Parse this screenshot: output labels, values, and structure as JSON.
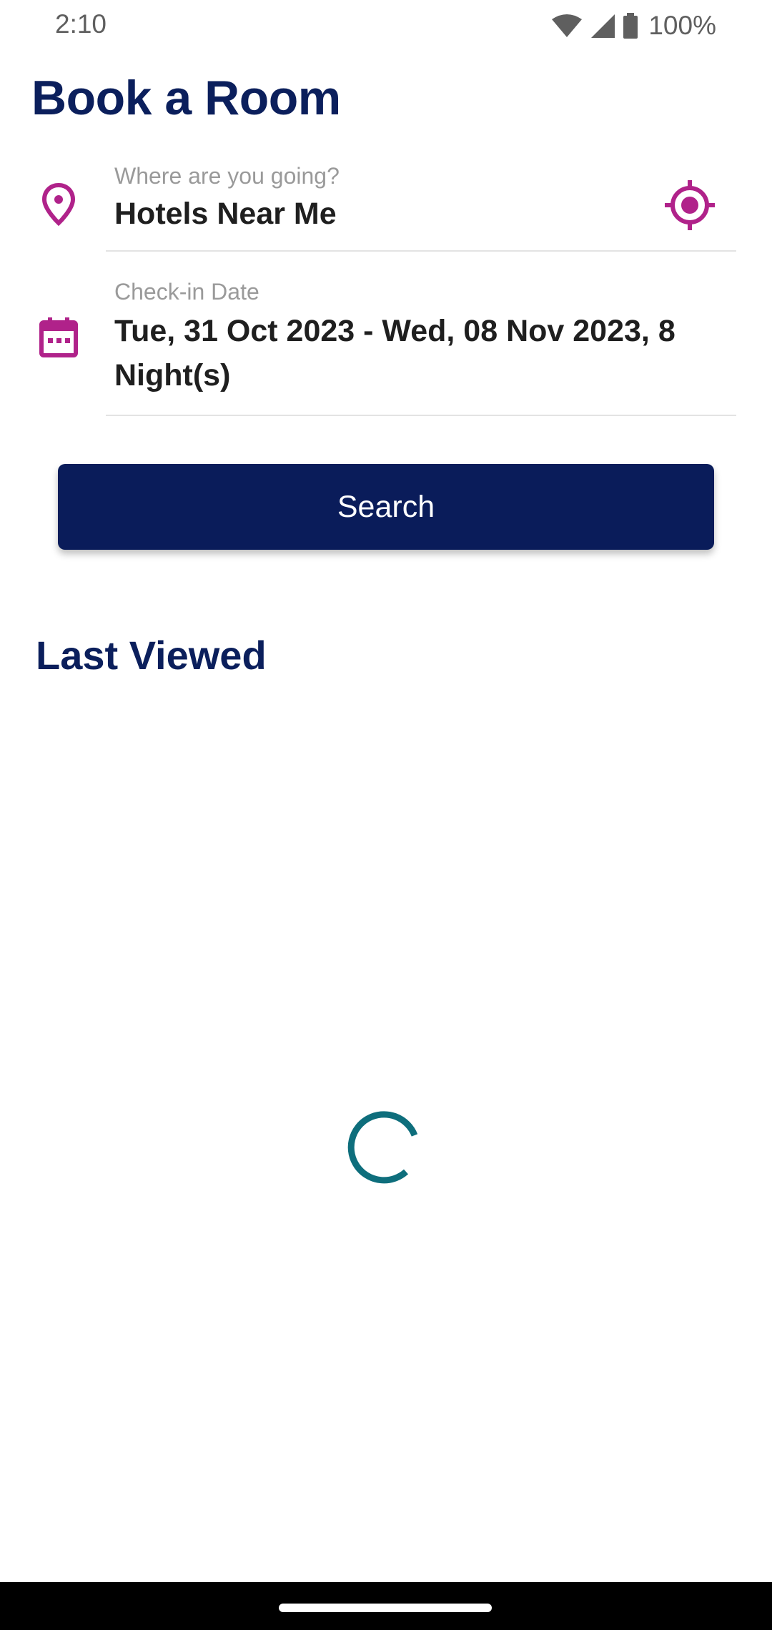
{
  "status_bar": {
    "time": "2:10",
    "battery_percent": "100%",
    "icons": [
      "wifi-icon",
      "cell-signal-icon",
      "battery-icon"
    ]
  },
  "page": {
    "title": "Book a Room"
  },
  "destination": {
    "label": "Where are you going?",
    "value": "Hotels Near Me",
    "icon": "location-pin-icon",
    "action_icon": "my-location-icon"
  },
  "dates": {
    "label": "Check-in Date",
    "value": "Tue, 31 Oct 2023 - Wed, 08 Nov 2023, 8 Night(s)",
    "icon": "calendar-icon"
  },
  "search_button": {
    "label": "Search"
  },
  "last_viewed": {
    "title": "Last Viewed",
    "loading": true
  },
  "colors": {
    "brand_navy": "#0a1c5a",
    "accent_magenta": "#b0228a",
    "spinner_teal": "#0e6e7c"
  }
}
